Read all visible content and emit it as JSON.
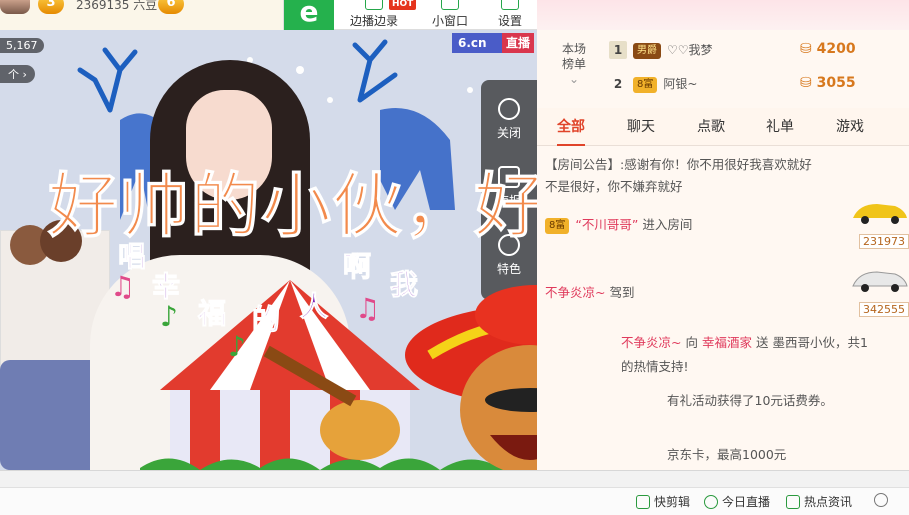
{
  "topbar": {
    "level_left": "3",
    "fans_text": "2369135 六豆",
    "level_right": "6"
  },
  "toolbar": {
    "edge_watch": "边播边录",
    "hot_tag": "HOT",
    "mini_window": "小窗口",
    "settings": "设置"
  },
  "video": {
    "viewer_count": "5,167",
    "gift_pill": "个 ›",
    "brand": "6.cn",
    "live_tag": "直播",
    "side_buttons": [
      "关闭",
      "海报",
      "特色"
    ],
    "overlay_text": "好帅的小伙，好like",
    "lyric_chars": [
      "唱",
      "幸",
      "福",
      "的",
      "人",
      "啊",
      "我"
    ]
  },
  "ranking": {
    "label_line1": "本场",
    "label_line2": "榜单",
    "rows": [
      {
        "rank": "1",
        "badge": "男爵",
        "name": "♡♡我梦",
        "coins": "4200"
      },
      {
        "rank": "2",
        "badge": "8富",
        "name": "阿银~",
        "coins": "3055"
      }
    ]
  },
  "tabs": [
    "全部",
    "聊天",
    "点歌",
    "礼单",
    "游戏"
  ],
  "chat": {
    "announcement_tag": "【房间公告】:",
    "announcement_rest": "感谢有你！你不用很好我喜欢就好",
    "announcement_line2": "不是很好，你不嫌弃就好",
    "entry_badge": "8富",
    "entry_name": "“不川哥哥”",
    "entry_action": "进入房间",
    "car_user": "不争炎凉~",
    "car_action": "驾到",
    "car_num1": "231973",
    "car_num2": "342555",
    "gift_from": "不争炎凉~",
    "gift_to_word": "向",
    "gift_to": "幸福酒家",
    "gift_send": "送",
    "gift_item": "墨西哥小伙，共1",
    "thanks": "的热情支持!",
    "promo": "有礼活动获得了10元话费券。",
    "promo2": "京东卡，最高1000元"
  },
  "statusbar": {
    "items": [
      "快剪辑",
      "今日直播",
      "热点资讯"
    ]
  }
}
